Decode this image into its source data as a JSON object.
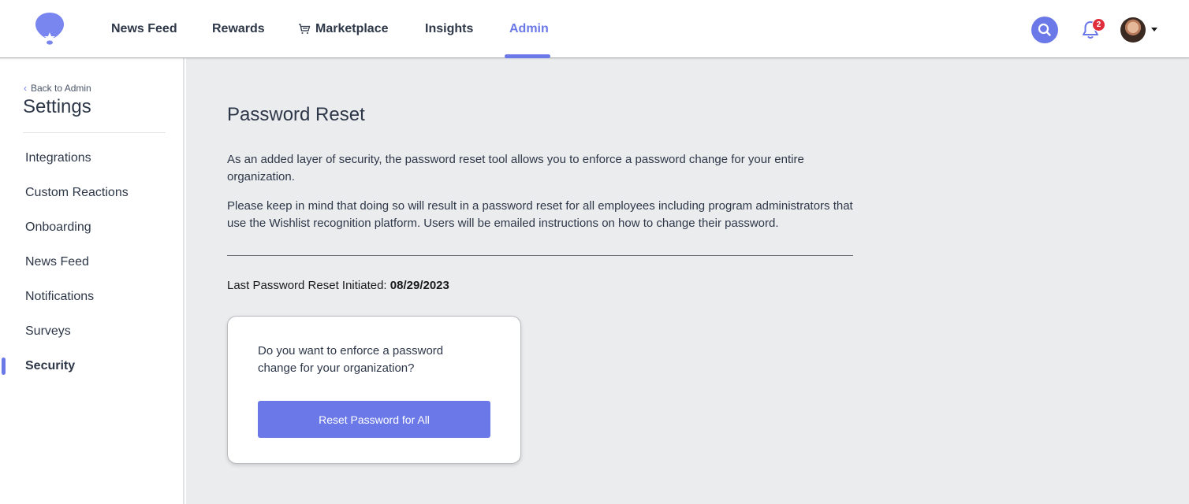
{
  "nav": {
    "logo": "wishlist-balloon-logo",
    "items": [
      {
        "label": "News Feed",
        "active": false
      },
      {
        "label": "Rewards",
        "active": false
      },
      {
        "label": "Marketplace",
        "active": false,
        "icon": "cart-icon"
      },
      {
        "label": "Insights",
        "active": false
      },
      {
        "label": "Admin",
        "active": true
      }
    ],
    "search_icon": "search-icon",
    "notifications": {
      "icon": "bell-icon",
      "count": "2"
    },
    "avatar_menu_icon": "caret-down-icon"
  },
  "colors": {
    "accent": "#6b78e8",
    "badge": "#e02d3c",
    "main_bg": "#ebecee",
    "text": "#2d3748"
  },
  "sidebar": {
    "back_label": "Back to Admin",
    "title": "Settings",
    "items": [
      {
        "label": "Integrations",
        "active": false
      },
      {
        "label": "Custom Reactions",
        "active": false
      },
      {
        "label": "Onboarding",
        "active": false
      },
      {
        "label": "News Feed",
        "active": false
      },
      {
        "label": "Notifications",
        "active": false
      },
      {
        "label": "Surveys",
        "active": false
      },
      {
        "label": "Security",
        "active": true
      }
    ]
  },
  "main": {
    "title": "Password Reset",
    "paragraph1": "As an added layer of security, the password reset tool allows you to enforce a password change for your entire organization.",
    "paragraph2": "Please keep in mind that doing so will result in a password reset for all employees including program administrators that use the Wishlist recognition platform. Users will be emailed instructions on how to change their password.",
    "last_reset_label": "Last Password Reset Initiated:",
    "last_reset_date": "08/29/2023",
    "card": {
      "question": "Do you want to enforce a password change for your organization?",
      "button_label": "Reset Password for All"
    }
  }
}
